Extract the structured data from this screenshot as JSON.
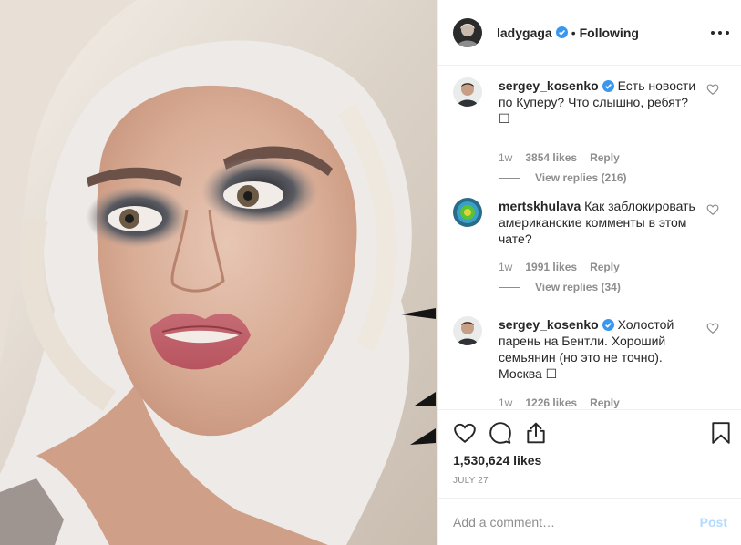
{
  "colors": {
    "accent": "#0095f6",
    "verified": "#3897f0",
    "muted": "#8e8e8e",
    "text": "#262626",
    "post_disabled": "#b3dbff"
  },
  "header": {
    "username": "ladygaga",
    "separator": "•",
    "following_label": "Following"
  },
  "comments": [
    {
      "username": "sergey_kosenko",
      "verified": true,
      "text": "Есть новости по Куперу? Что слышно, ребят? ☐",
      "time": "1w",
      "likes": "3854 likes",
      "reply_label": "Reply",
      "view_replies": "View replies (216)"
    },
    {
      "username": "mertskhulava",
      "verified": false,
      "text": "Как заблокировать американские комменты в этом чате?",
      "time": "1w",
      "likes": "1991 likes",
      "reply_label": "Reply",
      "view_replies": "View replies (34)"
    },
    {
      "username": "sergey_kosenko",
      "verified": true,
      "text": "Холостой парень на Бентли. Хороший семьянин (но это не точно). Москва ☐",
      "time": "1w",
      "likes": "1226 likes",
      "reply_label": "Reply"
    }
  ],
  "post": {
    "likes": "1,530,624 likes",
    "date": "July 27"
  },
  "add_comment": {
    "placeholder": "Add a comment…",
    "post_label": "Post"
  },
  "icons": [
    "more-icon",
    "verified-icon",
    "heart-icon",
    "comment-icon",
    "share-icon",
    "bookmark-icon"
  ]
}
